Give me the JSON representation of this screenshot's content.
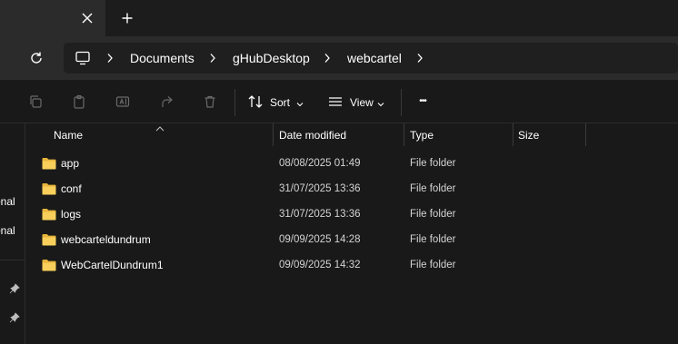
{
  "tab": {
    "close_glyph": "✕",
    "new_glyph": "+"
  },
  "address": {
    "crumbs": [
      "Documents",
      "gHubDesktop",
      "webcartel"
    ]
  },
  "toolbar": {
    "sort_label": "Sort",
    "view_label": "View",
    "more_glyph": "•••"
  },
  "navpane": {
    "items": [
      "onal",
      "onal"
    ]
  },
  "columns": {
    "name": "Name",
    "date": "Date modified",
    "type": "Type",
    "size": "Size"
  },
  "files": [
    {
      "name": "app",
      "date": "08/08/2025 01:49",
      "type": "File folder"
    },
    {
      "name": "conf",
      "date": "31/07/2025 13:36",
      "type": "File folder"
    },
    {
      "name": "logs",
      "date": "31/07/2025 13:36",
      "type": "File folder"
    },
    {
      "name": "webcarteldundrum",
      "date": "09/09/2025 14:28",
      "type": "File folder"
    },
    {
      "name": "WebCartelDundrum1",
      "date": "09/09/2025 14:32",
      "type": "File folder"
    }
  ],
  "colors": {
    "accent_folder": "#f1c34f",
    "background": "#191919",
    "address_row": "#2b2b2b"
  }
}
